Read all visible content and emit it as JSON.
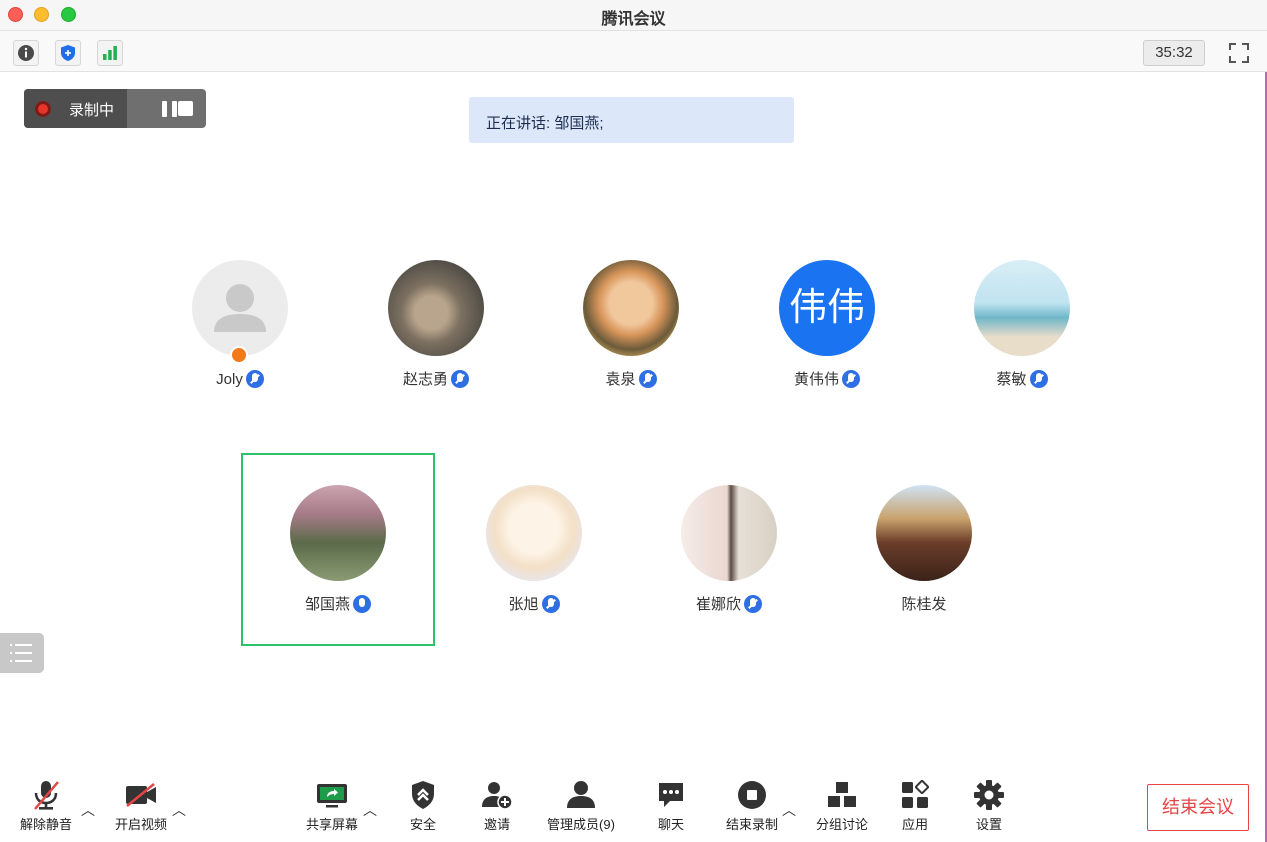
{
  "window": {
    "title": "腾讯会议"
  },
  "toolbar": {
    "timer": "35:32"
  },
  "recording": {
    "label": "录制中"
  },
  "speaking": {
    "text": "正在讲话: 邹国燕;"
  },
  "members": [
    {
      "name": "Joly",
      "avatar_text": ""
    },
    {
      "name": "赵志勇",
      "avatar_text": ""
    },
    {
      "name": "袁泉",
      "avatar_text": ""
    },
    {
      "name": "黄伟伟",
      "avatar_text": "伟伟"
    },
    {
      "name": "蔡敏",
      "avatar_text": ""
    },
    {
      "name": "邹国燕",
      "avatar_text": ""
    },
    {
      "name": "张旭",
      "avatar_text": ""
    },
    {
      "name": "崔娜欣",
      "avatar_text": ""
    },
    {
      "name": "陈桂发",
      "avatar_text": ""
    }
  ],
  "controls": {
    "unmute": "解除静音",
    "video": "开启视频",
    "share": "共享屏幕",
    "security": "安全",
    "invite": "邀请",
    "members": "管理成员(9)",
    "chat": "聊天",
    "end_record": "结束录制",
    "breakout": "分组讨论",
    "apps": "应用",
    "settings": "设置"
  },
  "end_meeting": "结束会议",
  "colors": {
    "accent": "#2e6fe3",
    "speaker_frame": "#2bc26b",
    "end": "#e54545",
    "avatar_blue": "#1a73f0"
  }
}
